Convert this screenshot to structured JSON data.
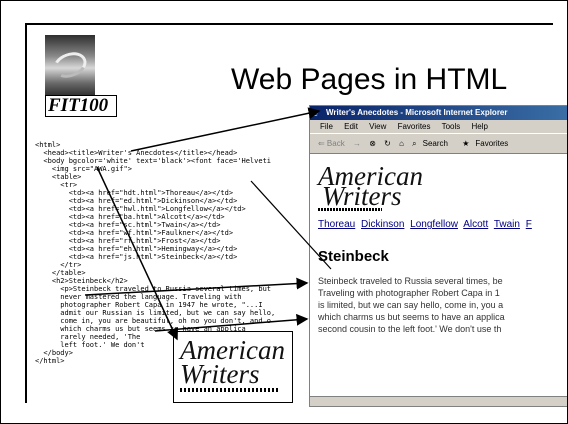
{
  "slide": {
    "title": "Web Pages in HTML",
    "course_label": "FIT100"
  },
  "code_lines": [
    "<html>",
    "  <head><title>Writer's Anecdotes</title></head>",
    "  <body bgcolor='white' text='black'><font face='Helveti",
    "    <img src=\"AWA.gif\">",
    "    <table>",
    "      <tr>",
    "        <td><a href=\"hdt.html\">Thoreau</a></td>",
    "        <td><a href=\"ed.html\">Dickinson</a></td>",
    "        <td><a href=\"hwl.html\">Longfellow</a></td>",
    "        <td><a href=\"ba.html\">Alcott</a></td>",
    "        <td><a href=\"sc.html\">Twain</a></td>",
    "        <td><a href=\"wf.html\">Faulkner</a></td>",
    "        <td><a href=\"rf.html\">Frost</a></td>",
    "        <td><a href=\"eh.html\">Hemingway</a></td>",
    "        <td><a href=\"js.html\">Steinbeck</a></td>",
    "      </tr>",
    "    </table>",
    "    <h2>Steinbeck</h2>",
    "      <p>Steinbeck traveled to Russia several times, but",
    "      never mastered the language. Traveling with",
    "      photographer Robert Capa in 1947 he wrote, \"...I",
    "      admit our Russian is limited, but we can say hello,",
    "      come in, you are beautiful, oh no you don't, and o",
    "      which charms us but seems to have an applica",
    "      rarely needed, 'The",
    "      left foot.' We don't",
    "  </body>",
    "</html>"
  ],
  "browser": {
    "window_title": "Writer's Anecdotes - Microsoft Internet Explorer",
    "menu": [
      "File",
      "Edit",
      "View",
      "Favorites",
      "Tools",
      "Help"
    ],
    "toolbar": {
      "back": "⇐ Back",
      "forward": "→",
      "search": "Search",
      "favorites": "Favorites"
    },
    "logo_line1": "American",
    "logo_line2": "Writers",
    "nav_links": [
      "Thoreau",
      "Dickinson",
      "Longfellow",
      "Alcott",
      "Twain",
      "F"
    ],
    "heading": "Steinbeck",
    "paragraph_lines": [
      "Steinbeck traveled to Russia several times, be",
      "Traveling with photographer Robert Capa in 1",
      "is limited, but we can say hello, come in, you a",
      "which charms us but seems to have an applica",
      "second cousin to the left foot.' We don't use th"
    ]
  },
  "overlay_logo": {
    "line1": "American",
    "line2": "Writers"
  }
}
